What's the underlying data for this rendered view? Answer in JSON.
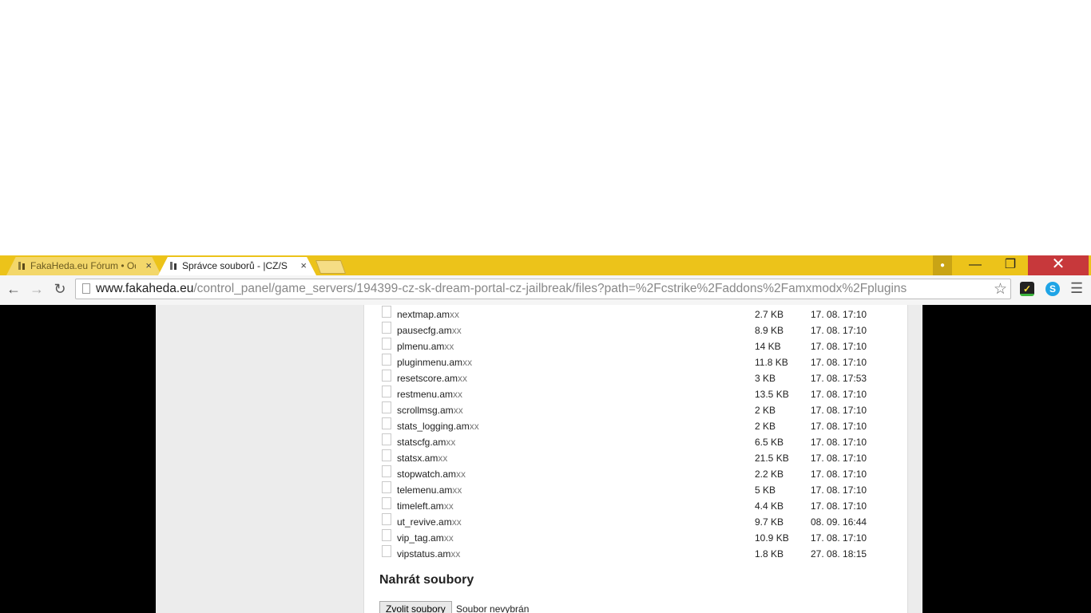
{
  "browser": {
    "tabs": [
      {
        "title": "FakaHeda.eu Fórum • Ode",
        "active": false
      },
      {
        "title": "Správce souborů - |CZ/SK|",
        "active": true
      }
    ],
    "tab_close_glyph": "×",
    "url_host": "www.fakaheda.eu",
    "url_path": "/control_panel/game_servers/194399-cz-sk-dream-portal-cz-jailbreak/files?path=%2Fcstrike%2Faddons%2Famxmodx%2Fplugins",
    "icons": {
      "back": "arrow-left-icon",
      "forward": "arrow-right-icon",
      "reload": "reload-icon",
      "bookmark": "star-icon",
      "menu": "hamburger-icon"
    },
    "tab_color": "#ecc31a",
    "close_color": "#c7383b"
  },
  "files": [
    {
      "name": "nextmap.am",
      "ext": "xx",
      "size": "2.7 KB",
      "date": "17. 08. 17:10"
    },
    {
      "name": "pausecfg.am",
      "ext": "xx",
      "size": "8.9 KB",
      "date": "17. 08. 17:10"
    },
    {
      "name": "plmenu.am",
      "ext": "xx",
      "size": "14 KB",
      "date": "17. 08. 17:10"
    },
    {
      "name": "pluginmenu.am",
      "ext": "xx",
      "size": "11.8 KB",
      "date": "17. 08. 17:10"
    },
    {
      "name": "resetscore.am",
      "ext": "xx",
      "size": "3 KB",
      "date": "17. 08. 17:53"
    },
    {
      "name": "restmenu.am",
      "ext": "xx",
      "size": "13.5 KB",
      "date": "17. 08. 17:10"
    },
    {
      "name": "scrollmsg.am",
      "ext": "xx",
      "size": "2 KB",
      "date": "17. 08. 17:10"
    },
    {
      "name": "stats_logging.am",
      "ext": "xx",
      "size": "2 KB",
      "date": "17. 08. 17:10"
    },
    {
      "name": "statscfg.am",
      "ext": "xx",
      "size": "6.5 KB",
      "date": "17. 08. 17:10"
    },
    {
      "name": "statsx.am",
      "ext": "xx",
      "size": "21.5 KB",
      "date": "17. 08. 17:10"
    },
    {
      "name": "stopwatch.am",
      "ext": "xx",
      "size": "2.2 KB",
      "date": "17. 08. 17:10"
    },
    {
      "name": "telemenu.am",
      "ext": "xx",
      "size": "5 KB",
      "date": "17. 08. 17:10"
    },
    {
      "name": "timeleft.am",
      "ext": "xx",
      "size": "4.4 KB",
      "date": "17. 08. 17:10"
    },
    {
      "name": "ut_revive.am",
      "ext": "xx",
      "size": "9.7 KB",
      "date": "08. 09. 16:44"
    },
    {
      "name": "vip_tag.am",
      "ext": "xx",
      "size": "10.9 KB",
      "date": "17. 08. 17:10"
    },
    {
      "name": "vipstatus.am",
      "ext": "xx",
      "size": "1.8 KB",
      "date": "27. 08. 18:15"
    }
  ],
  "upload": {
    "heading": "Nahrát soubory",
    "choose_label": "Zvolit soubory",
    "no_file_text": "Soubor nevybrán"
  }
}
